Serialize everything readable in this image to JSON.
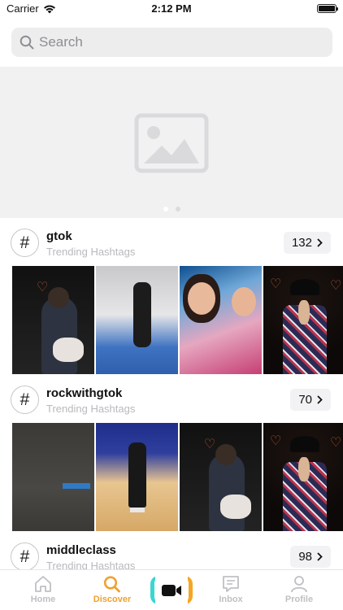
{
  "status_bar": {
    "carrier": "Carrier",
    "time": "2:12 PM"
  },
  "search": {
    "placeholder": "Search"
  },
  "banner": {
    "slide_count": 2,
    "active_slide": 1,
    "icon": "image-placeholder-icon"
  },
  "sections": [
    {
      "title": "gtok",
      "subtitle": "Trending Hashtags",
      "count": "132"
    },
    {
      "title": "rockwithgtok",
      "subtitle": "Trending Hashtags",
      "count": "70"
    },
    {
      "title": "middleclass",
      "subtitle": "Trending Hashtags",
      "count": "98"
    }
  ],
  "tabs": [
    {
      "label": "Home",
      "icon": "home-icon"
    },
    {
      "label": "Discover",
      "icon": "search-icon",
      "active": true
    },
    {
      "label": "",
      "icon": "video-camera-icon"
    },
    {
      "label": "Inbox",
      "icon": "message-icon"
    },
    {
      "label": "Profile",
      "icon": "user-icon"
    }
  ],
  "colors": {
    "accent": "#f0a030",
    "record_left": "#3ad6d0",
    "record_right": "#f5a623"
  }
}
